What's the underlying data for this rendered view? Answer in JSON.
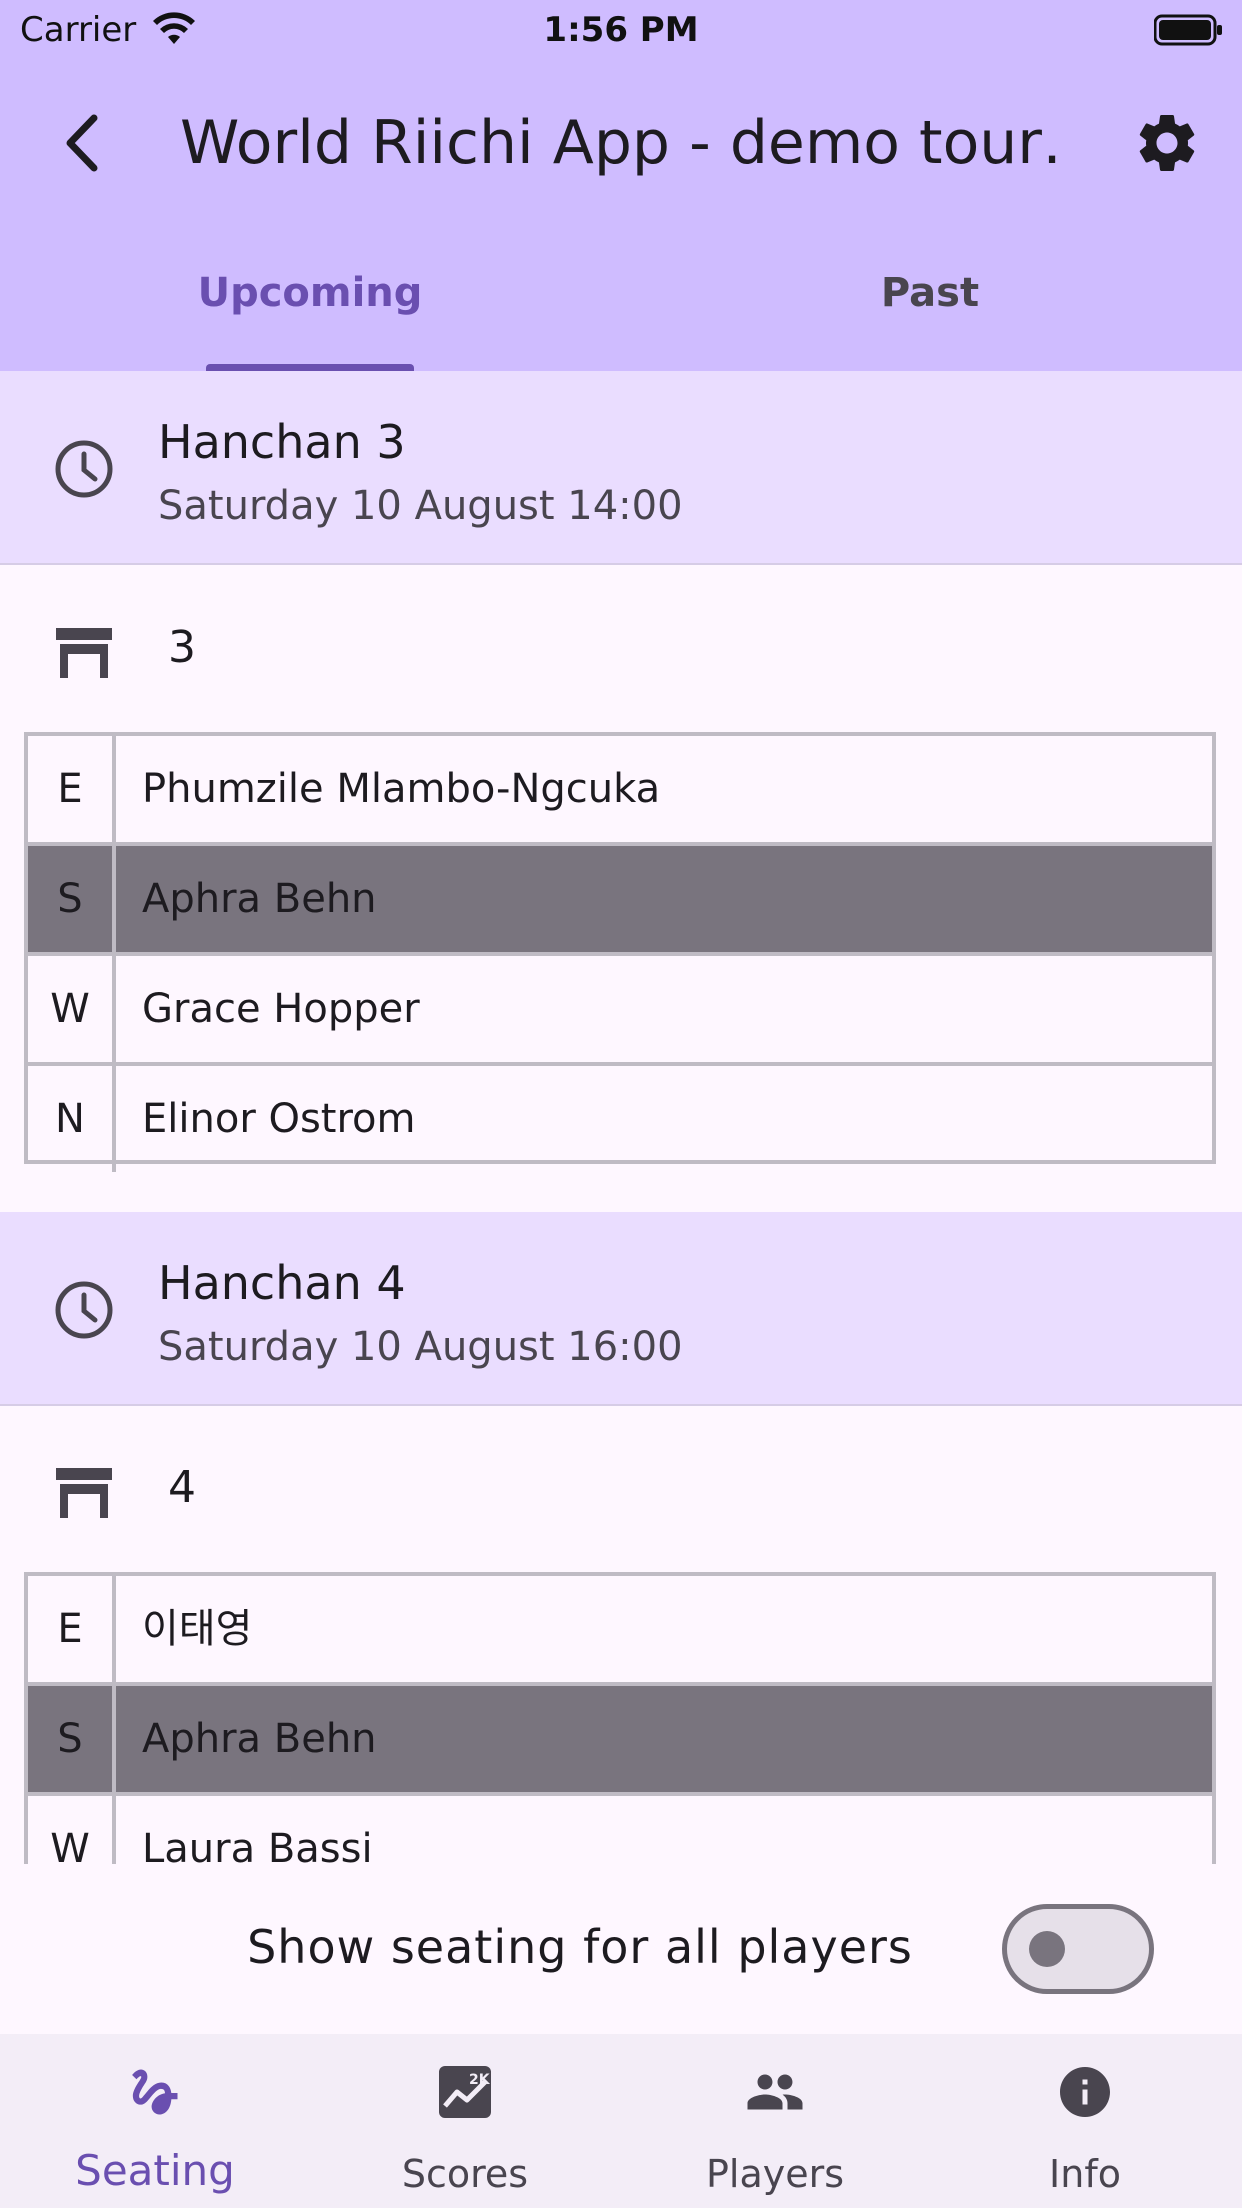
{
  "status_bar": {
    "carrier": "Carrier",
    "time": "1:56 PM"
  },
  "header": {
    "title": "World Riichi App - demo tour…"
  },
  "tabs": [
    {
      "label": "Upcoming",
      "active": true
    },
    {
      "label": "Past",
      "active": false
    }
  ],
  "sessions": [
    {
      "title": "Hanchan 3",
      "time": "Saturday 10 August 14:00",
      "table": "3",
      "seats": [
        {
          "wind": "E",
          "player": "Phumzile Mlambo-Ngcuka",
          "highlighted": false
        },
        {
          "wind": "S",
          "player": "Aphra Behn",
          "highlighted": true
        },
        {
          "wind": "W",
          "player": "Grace Hopper",
          "highlighted": false
        },
        {
          "wind": "N",
          "player": "Elinor Ostrom",
          "highlighted": false
        }
      ]
    },
    {
      "title": "Hanchan 4",
      "time": "Saturday 10 August 16:00",
      "table": "4",
      "seats": [
        {
          "wind": "E",
          "player": "이태영",
          "highlighted": false
        },
        {
          "wind": "S",
          "player": "Aphra Behn",
          "highlighted": true
        },
        {
          "wind": "W",
          "player": "Laura Bassi",
          "highlighted": false
        }
      ]
    }
  ],
  "toggle": {
    "label": "Show seating for all players",
    "on": false
  },
  "bottom_nav": [
    {
      "label": "Seating",
      "icon": "seat-icon",
      "active": true
    },
    {
      "label": "Scores",
      "icon": "scores-icon",
      "active": false
    },
    {
      "label": "Players",
      "icon": "people-icon",
      "active": false
    },
    {
      "label": "Info",
      "icon": "info-icon",
      "active": false
    }
  ],
  "colors": {
    "header_bg": "#CFBCFF",
    "session_bg": "#EADDFF",
    "accent": "#6A4FB0",
    "highlight_row": "#79747E",
    "page_bg": "#FEF7FF"
  }
}
